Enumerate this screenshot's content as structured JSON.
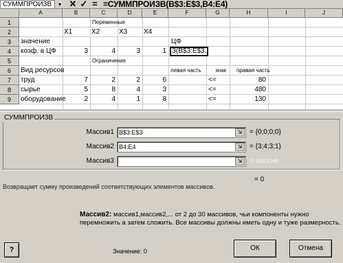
{
  "formula_bar": {
    "name_box": "СУММПРОИЗВ",
    "name_arrow": "▾",
    "cancel_icon": "✕",
    "accept_icon": "✓",
    "equals_icon": "=",
    "formula": "=СУММПРОИЗВ(B$3:E$3,B4:E4)"
  },
  "sheet": {
    "columns": [
      "A",
      "B",
      "C",
      "D",
      "E",
      "F",
      "G",
      "H",
      "I",
      "J"
    ],
    "rows": [
      "1",
      "2",
      "3",
      "4",
      "5",
      "6",
      "7",
      "8",
      "9"
    ],
    "r1": {
      "c": "Переменные"
    },
    "r2": {
      "b": "X1",
      "c": "X2",
      "d": "X3",
      "e": "X4"
    },
    "r3": {
      "a": "значение",
      "f": "ЦФ"
    },
    "r4": {
      "a": "коэф. в ЦФ",
      "b": "3",
      "c": "4",
      "d": "3",
      "e": "1",
      "f": "З(B$3:E$3,"
    },
    "r5": {
      "c": "Ограничения"
    },
    "r6": {
      "a": "Вид ресурсов",
      "f": "левая часть",
      "g": "знак",
      "h": "правая часть"
    },
    "r7": {
      "a": "труд",
      "b": "7",
      "c": "2",
      "d": "2",
      "e": "6",
      "g": "<=",
      "h": "80"
    },
    "r8": {
      "a": "сырье",
      "b": "5",
      "c": "8",
      "d": "4",
      "e": "3",
      "g": "<=",
      "h": "480"
    },
    "r9": {
      "a": "оборудование",
      "b": "2",
      "c": "4",
      "d": "1",
      "e": "8",
      "g": "<=",
      "h": "130"
    }
  },
  "dialog": {
    "group_title": "СУММПРОИЗВ",
    "args": [
      {
        "label": "Массив1",
        "value": "B$3:E$3",
        "result": "= {0;0;0;0}"
      },
      {
        "label": "Массив2",
        "value": "B4:E4",
        "result": "= {3;4;3;1}"
      },
      {
        "label": "Массив3",
        "value": "",
        "result": "= массив"
      }
    ],
    "collapse_icon": "⇲",
    "total": "= 0",
    "description": "Возвращает сумму произведений соответствующих элементов массивов.",
    "arg_help_name": "Массив2:",
    "arg_help_text": "массив1,массив2,... от 2 до 30 массивов, чьи компоненты нужно перемножить а затем сложить. Все массивы должны иметь одну и туже размерность.",
    "help_icon": "?",
    "value_label": "Значение: 0",
    "ok_label": "ОК",
    "cancel_label": "Отмена"
  }
}
